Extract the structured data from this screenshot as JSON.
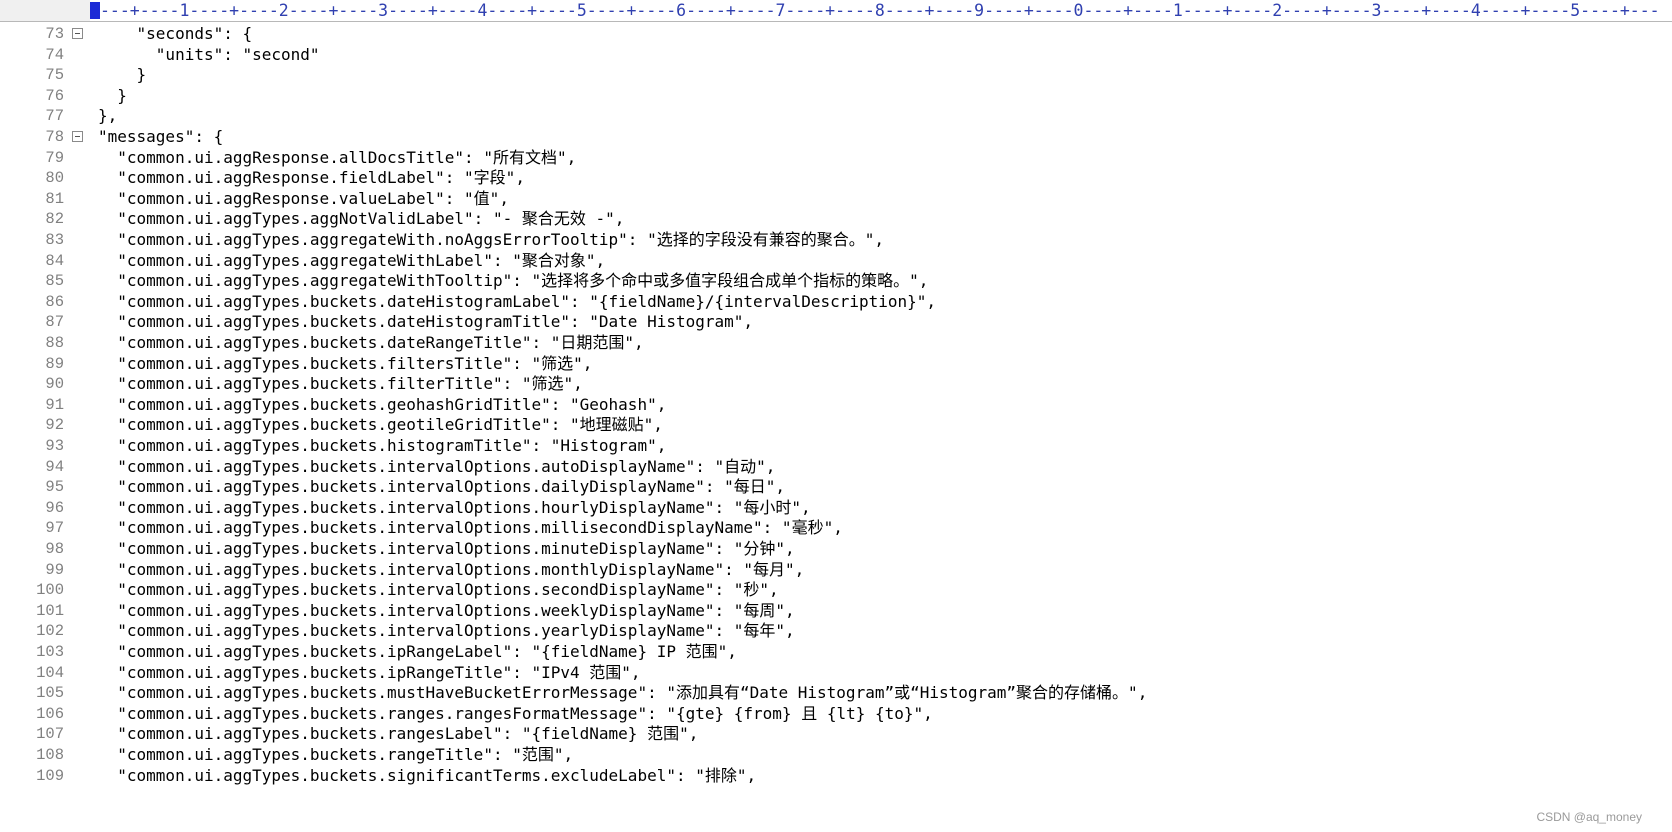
{
  "ruler": {
    "text": "---+----1----+----2----+----3----+----4----+----5----+----6----+----7----+----8----+----9----+----0----+----1----+----2----+----3----+----4----+----5----+---"
  },
  "lines": [
    {
      "num": "73",
      "fold": true,
      "text": "    \"seconds\": {"
    },
    {
      "num": "74",
      "fold": false,
      "text": "      \"units\": \"second\""
    },
    {
      "num": "75",
      "fold": false,
      "text": "    }"
    },
    {
      "num": "76",
      "fold": false,
      "text": "  }"
    },
    {
      "num": "77",
      "fold": false,
      "text": "},"
    },
    {
      "num": "78",
      "fold": true,
      "text": "\"messages\": {"
    },
    {
      "num": "79",
      "fold": false,
      "text": "  \"common.ui.aggResponse.allDocsTitle\": \"所有文档\","
    },
    {
      "num": "80",
      "fold": false,
      "text": "  \"common.ui.aggResponse.fieldLabel\": \"字段\","
    },
    {
      "num": "81",
      "fold": false,
      "text": "  \"common.ui.aggResponse.valueLabel\": \"值\","
    },
    {
      "num": "82",
      "fold": false,
      "text": "  \"common.ui.aggTypes.aggNotValidLabel\": \"- 聚合无效 -\","
    },
    {
      "num": "83",
      "fold": false,
      "text": "  \"common.ui.aggTypes.aggregateWith.noAggsErrorTooltip\": \"选择的字段没有兼容的聚合。\","
    },
    {
      "num": "84",
      "fold": false,
      "text": "  \"common.ui.aggTypes.aggregateWithLabel\": \"聚合对象\","
    },
    {
      "num": "85",
      "fold": false,
      "text": "  \"common.ui.aggTypes.aggregateWithTooltip\": \"选择将多个命中或多值字段组合成单个指标的策略。\","
    },
    {
      "num": "86",
      "fold": false,
      "text": "  \"common.ui.aggTypes.buckets.dateHistogramLabel\": \"{fieldName}/{intervalDescription}\","
    },
    {
      "num": "87",
      "fold": false,
      "text": "  \"common.ui.aggTypes.buckets.dateHistogramTitle\": \"Date Histogram\","
    },
    {
      "num": "88",
      "fold": false,
      "text": "  \"common.ui.aggTypes.buckets.dateRangeTitle\": \"日期范围\","
    },
    {
      "num": "89",
      "fold": false,
      "text": "  \"common.ui.aggTypes.buckets.filtersTitle\": \"筛选\","
    },
    {
      "num": "90",
      "fold": false,
      "text": "  \"common.ui.aggTypes.buckets.filterTitle\": \"筛选\","
    },
    {
      "num": "91",
      "fold": false,
      "text": "  \"common.ui.aggTypes.buckets.geohashGridTitle\": \"Geohash\","
    },
    {
      "num": "92",
      "fold": false,
      "text": "  \"common.ui.aggTypes.buckets.geotileGridTitle\": \"地理磁贴\","
    },
    {
      "num": "93",
      "fold": false,
      "text": "  \"common.ui.aggTypes.buckets.histogramTitle\": \"Histogram\","
    },
    {
      "num": "94",
      "fold": false,
      "text": "  \"common.ui.aggTypes.buckets.intervalOptions.autoDisplayName\": \"自动\","
    },
    {
      "num": "95",
      "fold": false,
      "text": "  \"common.ui.aggTypes.buckets.intervalOptions.dailyDisplayName\": \"每日\","
    },
    {
      "num": "96",
      "fold": false,
      "text": "  \"common.ui.aggTypes.buckets.intervalOptions.hourlyDisplayName\": \"每小时\","
    },
    {
      "num": "97",
      "fold": false,
      "text": "  \"common.ui.aggTypes.buckets.intervalOptions.millisecondDisplayName\": \"毫秒\","
    },
    {
      "num": "98",
      "fold": false,
      "text": "  \"common.ui.aggTypes.buckets.intervalOptions.minuteDisplayName\": \"分钟\","
    },
    {
      "num": "99",
      "fold": false,
      "text": "  \"common.ui.aggTypes.buckets.intervalOptions.monthlyDisplayName\": \"每月\","
    },
    {
      "num": "100",
      "fold": false,
      "text": "  \"common.ui.aggTypes.buckets.intervalOptions.secondDisplayName\": \"秒\","
    },
    {
      "num": "101",
      "fold": false,
      "text": "  \"common.ui.aggTypes.buckets.intervalOptions.weeklyDisplayName\": \"每周\","
    },
    {
      "num": "102",
      "fold": false,
      "text": "  \"common.ui.aggTypes.buckets.intervalOptions.yearlyDisplayName\": \"每年\","
    },
    {
      "num": "103",
      "fold": false,
      "text": "  \"common.ui.aggTypes.buckets.ipRangeLabel\": \"{fieldName} IP 范围\","
    },
    {
      "num": "104",
      "fold": false,
      "text": "  \"common.ui.aggTypes.buckets.ipRangeTitle\": \"IPv4 范围\","
    },
    {
      "num": "105",
      "fold": false,
      "text": "  \"common.ui.aggTypes.buckets.mustHaveBucketErrorMessage\": \"添加具有“Date Histogram”或“Histogram”聚合的存储桶。\","
    },
    {
      "num": "106",
      "fold": false,
      "text": "  \"common.ui.aggTypes.buckets.ranges.rangesFormatMessage\": \"{gte} {from} 且 {lt} {to}\","
    },
    {
      "num": "107",
      "fold": false,
      "text": "  \"common.ui.aggTypes.buckets.rangesLabel\": \"{fieldName} 范围\","
    },
    {
      "num": "108",
      "fold": false,
      "text": "  \"common.ui.aggTypes.buckets.rangeTitle\": \"范围\","
    },
    {
      "num": "109",
      "fold": false,
      "text": "  \"common.ui.aggTypes.buckets.significantTerms.excludeLabel\": \"排除\","
    }
  ],
  "watermark": "CSDN @aq_money"
}
